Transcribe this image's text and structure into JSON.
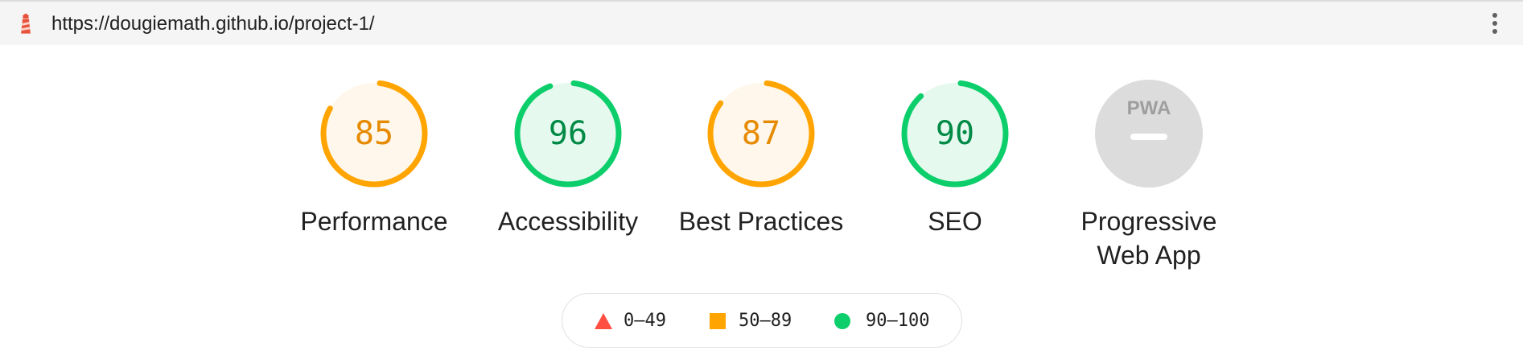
{
  "topbar": {
    "url": "https://dougiemath.github.io/project-1/",
    "logo_icon": "lighthouse-icon",
    "menu_icon": "kebab-menu-icon"
  },
  "colors": {
    "fail": "#ff4e42",
    "average": "#ffa400",
    "pass": "#0cce6b",
    "average_fill": "#fff7eb",
    "pass_fill": "#e6f9ef",
    "average_text": "#e68a00",
    "pass_text": "#008a45",
    "pwa_gray": "#dcdcdc"
  },
  "categories": [
    {
      "label": "Performance",
      "score": "85",
      "value": 0.85,
      "rating": "average"
    },
    {
      "label": "Accessibility",
      "score": "96",
      "value": 0.96,
      "rating": "pass"
    },
    {
      "label": "Best Practices",
      "score": "87",
      "value": 0.87,
      "rating": "average"
    },
    {
      "label": "SEO",
      "score": "90",
      "value": 0.9,
      "rating": "pass"
    },
    {
      "label_line1": "Progressive",
      "label_line2": "Web App",
      "badge": "PWA",
      "rating": "none"
    }
  ],
  "legend": {
    "fail_range": "0–49",
    "average_range": "50–89",
    "pass_range": "90–100"
  }
}
